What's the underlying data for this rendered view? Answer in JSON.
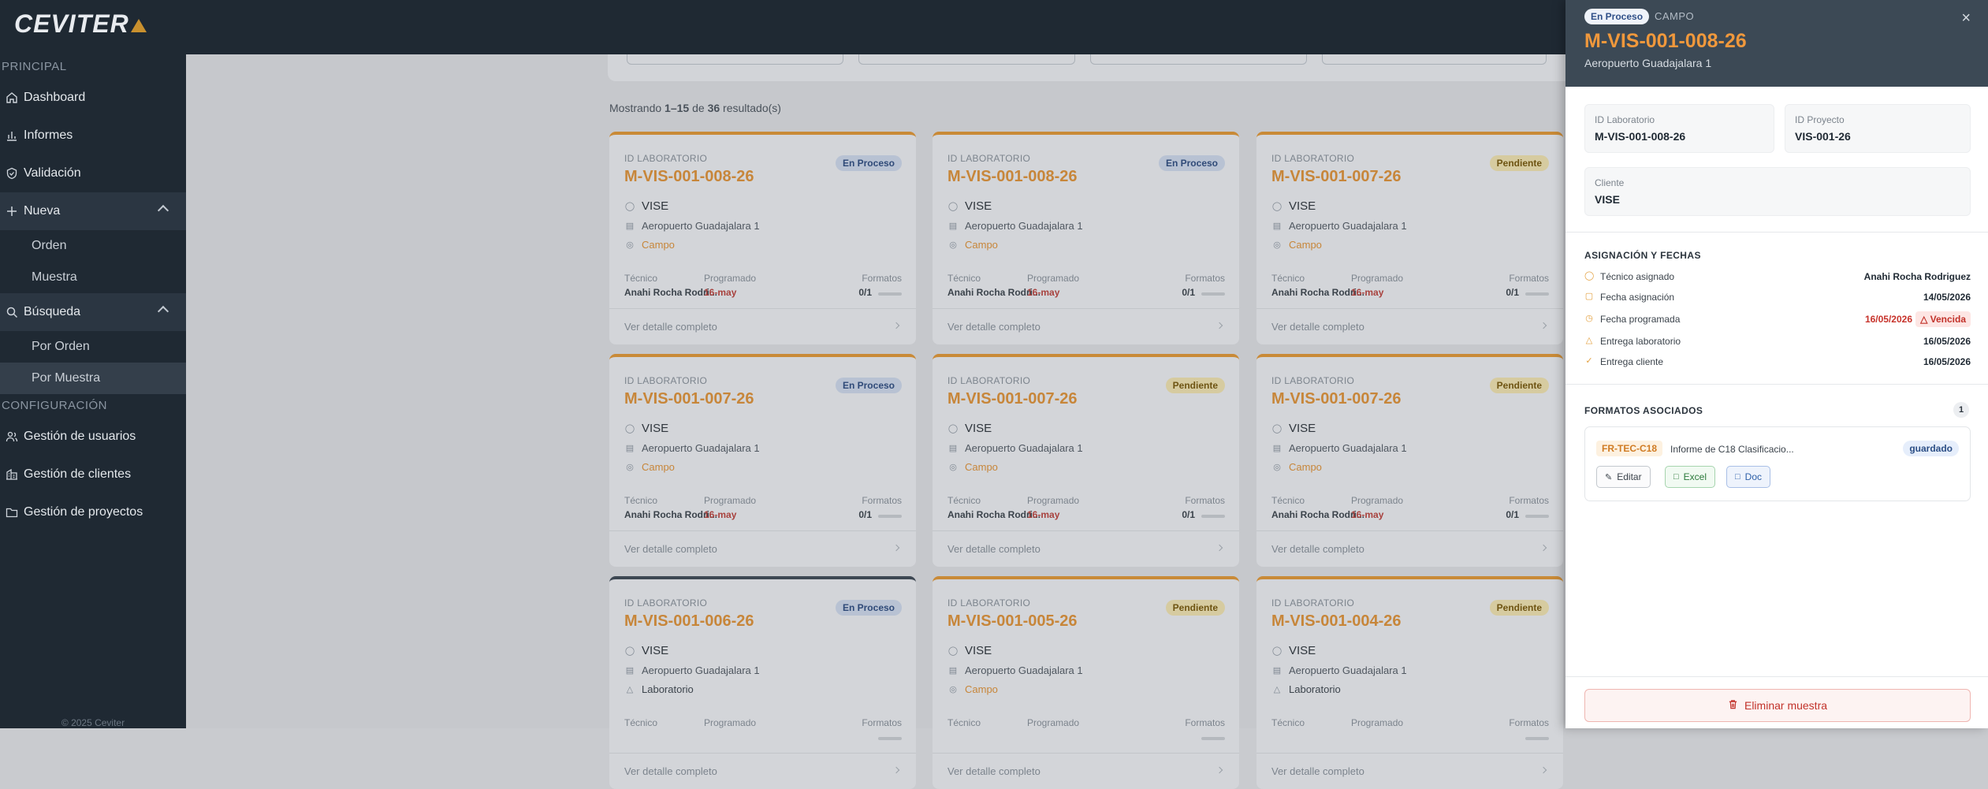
{
  "brand": {
    "name": "CEVITER"
  },
  "sidebar": {
    "sections": {
      "principal": "PRINCIPAL",
      "config": "CONFIGURACIÓN"
    },
    "items": {
      "dashboard": "Dashboard",
      "informes": "Informes",
      "validacion": "Validación",
      "nueva": "Nueva",
      "orden": "Orden",
      "muestra": "Muestra",
      "busqueda": "Búsqueda",
      "por_orden": "Por Orden",
      "por_muestra": "Por Muestra",
      "usuarios": "Gestión de usuarios",
      "clientes": "Gestión de clientes",
      "proyectos": "Gestión de proyectos"
    },
    "copyright": "© 2025 Ceviter"
  },
  "results": {
    "prefix": "Mostrando ",
    "range": "1–15",
    "mid": " de ",
    "total": "36",
    "suffix": " resultado(s)"
  },
  "card_labels": {
    "id": "ID LABORATORIO",
    "tecnico": "Técnico",
    "programado": "Programado",
    "formatos": "Formatos",
    "detalle": "Ver detalle completo"
  },
  "cards": [
    {
      "id": "M-VIS-001-008-26",
      "status": "En Proceso",
      "client": "VISE",
      "location": "Aeropuerto Guadajalara 1",
      "type": "Campo",
      "tecnico": "Anahi Rocha Rodri...",
      "date": "16-may",
      "formatos": "0/1"
    },
    {
      "id": "M-VIS-001-008-26",
      "status": "En Proceso",
      "client": "VISE",
      "location": "Aeropuerto Guadajalara 1",
      "type": "Campo",
      "tecnico": "Anahi Rocha Rodri...",
      "date": "16-may",
      "formatos": "0/1"
    },
    {
      "id": "M-VIS-001-007-26",
      "status": "Pendiente",
      "client": "VISE",
      "location": "Aeropuerto Guadajalara 1",
      "type": "Campo",
      "tecnico": "Anahi Rocha Rodri...",
      "date": "16-may",
      "formatos": "0/1"
    },
    {
      "id": "M-VIS-001-007-26",
      "status": "En Proceso",
      "client": "VISE",
      "location": "Aeropuerto Guadajalara 1",
      "type": "Campo",
      "tecnico": "Anahi Rocha Rodri...",
      "date": "16-may",
      "formatos": "0/1"
    },
    {
      "id": "M-VIS-001-007-26",
      "status": "Pendiente",
      "client": "VISE",
      "location": "Aeropuerto Guadajalara 1",
      "type": "Campo",
      "tecnico": "Anahi Rocha Rodri...",
      "date": "16-may",
      "formatos": "0/1"
    },
    {
      "id": "M-VIS-001-007-26",
      "status": "Pendiente",
      "client": "VISE",
      "location": "Aeropuerto Guadajalara 1",
      "type": "Campo",
      "tecnico": "Anahi Rocha Rodri...",
      "date": "16-may",
      "formatos": "0/1"
    },
    {
      "id": "M-VIS-001-006-26",
      "status": "En Proceso",
      "client": "VISE",
      "location": "Aeropuerto Guadajalara 1",
      "type": "Laboratorio",
      "tecnico": "",
      "date": "",
      "formatos": ""
    },
    {
      "id": "M-VIS-001-005-26",
      "status": "Pendiente",
      "client": "VISE",
      "location": "Aeropuerto Guadajalara 1",
      "type": "Campo",
      "tecnico": "",
      "date": "",
      "formatos": ""
    },
    {
      "id": "M-VIS-001-004-26",
      "status": "Pendiente",
      "client": "VISE",
      "location": "Aeropuerto Guadajalara 1",
      "type": "Laboratorio",
      "tecnico": "",
      "date": "",
      "formatos": ""
    }
  ],
  "panel": {
    "badge": "En Proceso",
    "tag": "CAMPO",
    "close": "×",
    "title": "M-VIS-001-008-26",
    "subtitle": "Aeropuerto Guadajalara 1",
    "info": {
      "lab_label": "ID Laboratorio",
      "lab_value": "M-VIS-001-008-26",
      "proj_label": "ID Proyecto",
      "proj_value": "VIS-001-26",
      "client_label": "Cliente",
      "client_value": "VISE"
    },
    "assign_title": "ASIGNACIÓN Y FECHAS",
    "assign": {
      "tecnico_label": "Técnico asignado",
      "tecnico_value": "Anahi Rocha Rodriguez",
      "fasig_label": "Fecha asignación",
      "fasig_value": "14/05/2026",
      "fprog_label": "Fecha programada",
      "fprog_value": "16/05/2026",
      "vencida": "Vencida",
      "elab_label": "Entrega laboratorio",
      "elab_value": "16/05/2026",
      "ecli_label": "Entrega cliente",
      "ecli_value": "16/05/2026"
    },
    "formatos_title": "FORMATOS ASOCIADOS",
    "formatos_count": "1",
    "formato": {
      "code": "FR-TEC-C18",
      "name": "Informe de C18 Clasificacio...",
      "status": "guardado",
      "edit": "Editar",
      "excel": "Excel",
      "doc": "Doc"
    },
    "delete": "Eliminar muestra"
  },
  "colors": {
    "accent": "#f0983c",
    "sidebar": "#1f2933",
    "danger": "#c2322a"
  }
}
